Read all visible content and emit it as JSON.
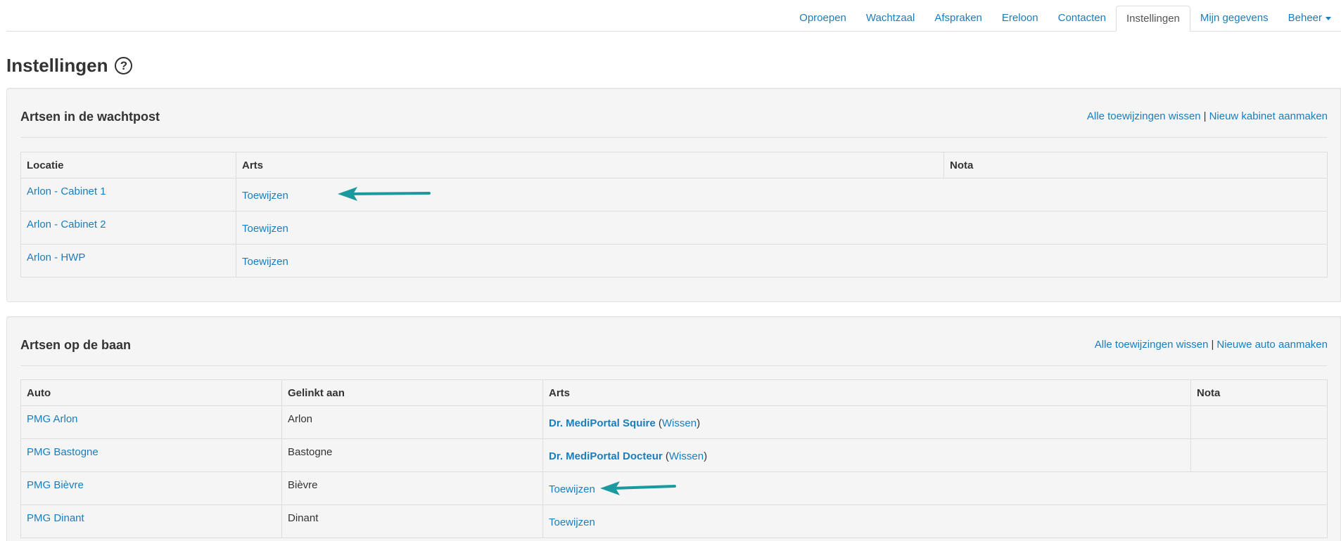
{
  "nav": {
    "tabs": [
      {
        "label": "Oproepen",
        "active": false
      },
      {
        "label": "Wachtzaal",
        "active": false
      },
      {
        "label": "Afspraken",
        "active": false
      },
      {
        "label": "Ereloon",
        "active": false
      },
      {
        "label": "Contacten",
        "active": false
      },
      {
        "label": "Instellingen",
        "active": true
      },
      {
        "label": "Mijn gegevens",
        "active": false
      },
      {
        "label": "Beheer",
        "active": false,
        "dropdown": true
      }
    ]
  },
  "page": {
    "title": "Instellingen",
    "help_icon": "question-circle-icon"
  },
  "panel1": {
    "title": "Artsen in de wachtpost",
    "actions": {
      "clear_label": "Alle toewijzingen wissen",
      "separator": "|",
      "new_label": "Nieuw kabinet aanmaken"
    },
    "columns": [
      "Locatie",
      "Arts",
      "Nota"
    ],
    "rows": [
      {
        "location": "Arlon - Cabinet 1",
        "doctor": "Toewijzen",
        "note": ""
      },
      {
        "location": "Arlon - Cabinet 2",
        "doctor": "Toewijzen",
        "note": ""
      },
      {
        "location": "Arlon - HWP",
        "doctor": "Toewijzen",
        "note": ""
      }
    ]
  },
  "panel2": {
    "title": "Artsen op de baan",
    "actions": {
      "clear_label": "Alle toewijzingen wissen",
      "separator": "|",
      "new_label": "Nieuwe auto aanmaken"
    },
    "columns": [
      "Auto",
      "Gelinkt aan",
      "Arts",
      "Nota"
    ],
    "rows": [
      {
        "car": "PMG Arlon",
        "linked": "Arlon",
        "doctor": "Dr. MediPortal Squire",
        "clear": "Wissen",
        "note": ""
      },
      {
        "car": "PMG Bastogne",
        "linked": "Bastogne",
        "doctor": "Dr. MediPortal Docteur",
        "clear": "Wissen",
        "note": ""
      },
      {
        "car": "PMG Bièvre",
        "linked": "Bièvre",
        "doctor": "Toewijzen",
        "note": ""
      },
      {
        "car": "PMG Dinant",
        "linked": "Dinant",
        "doctor": "Toewijzen",
        "note": ""
      }
    ]
  },
  "colors": {
    "link": "#1a7dbd",
    "arrow": "#1a9a9e",
    "panel_bg": "#f5f5f5"
  }
}
